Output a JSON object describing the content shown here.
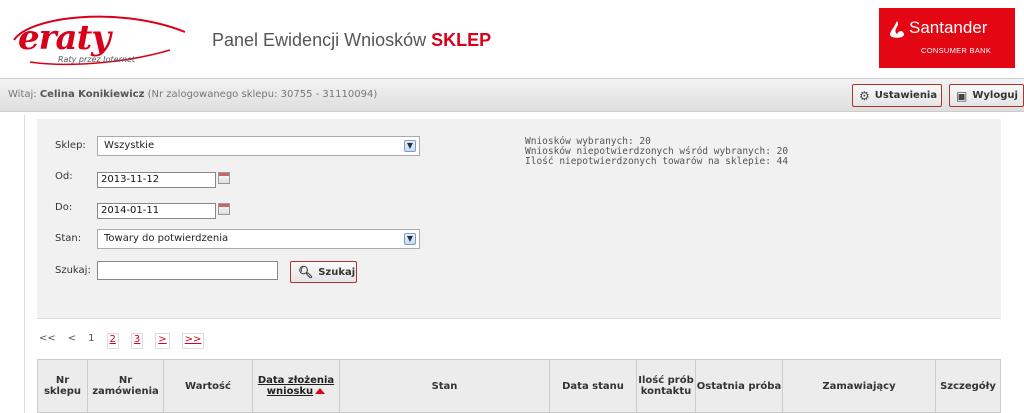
{
  "header": {
    "logo_text": "eraty",
    "logo_tagline": "Raty przez Internet",
    "title_prefix": "Panel Ewidencji Wniosków",
    "title_highlight": "SKLEP",
    "brand_name": "Santander",
    "brand_sub": "CONSUMER BANK"
  },
  "welcome": {
    "greeting": "Witaj:",
    "user_name": "Celina Konikiewicz",
    "shop_info": "(Nr zalogowanego sklepu: 30755 - 31110094)",
    "settings_label": "Ustawienia",
    "logout_label": "Wyloguj"
  },
  "filter": {
    "shop_label": "Sklep:",
    "shop_value": "Wszystkie",
    "from_label": "Od:",
    "from_value": "2013-11-12",
    "to_label": "Do:",
    "to_value": "2014-01-11",
    "state_label": "Stan:",
    "state_value": "Towary do potwierdzenia",
    "search_label": "Szukaj:",
    "search_value": "",
    "search_button": "Szukaj"
  },
  "stats": {
    "line1": "Wniosków wybranych: 20",
    "line2": "Wniosków niepotwierdzonych wśród wybranych: 20",
    "line3": "Ilość niepotwierdzonych towarów na sklepie: 44"
  },
  "pager": {
    "first": "<<",
    "prev": "<",
    "pages": [
      "1",
      "2",
      "3"
    ],
    "next": ">",
    "last": ">>"
  },
  "table": {
    "columns": [
      "Nr sklepu",
      "Nr zamówienia",
      "Wartość",
      "Data złożenia wniosku",
      "Stan",
      "Data stanu",
      "Ilość prób kontaktu",
      "Ostatnia próba",
      "Zamawiający",
      "Szczegóły"
    ]
  },
  "colors": {
    "brand_red": "#e30613",
    "accent_red": "#d9001b"
  }
}
